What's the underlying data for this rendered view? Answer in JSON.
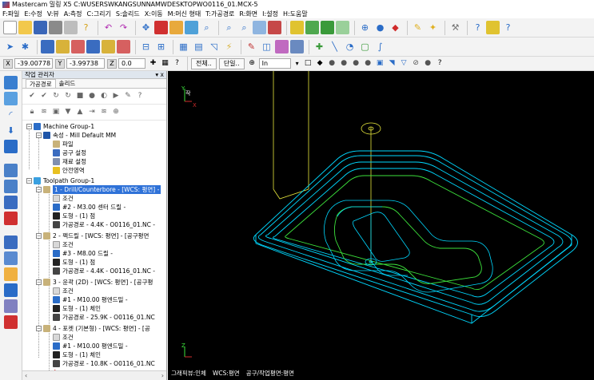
{
  "window": {
    "title": "Mastercam 밀링 X5  C:WUSERSWKANGSUNNAMWDESKTOPWO0116_01.MCX-5"
  },
  "menu": {
    "items": [
      "F:파일",
      "E:수정",
      "V:뷰",
      "A:측정",
      "C:그리기",
      "S:솔리드",
      "X:이동",
      "M:머신 형태",
      "T:가공경로",
      "R:화면",
      "I:설정",
      "H:도움말"
    ]
  },
  "coords": {
    "x_label": "X",
    "x_value": "-39.00778",
    "y_label": "Y",
    "y_value": "-3.99738",
    "z_label": "Z",
    "z_value": "0.0",
    "btn_all": "전체..",
    "btn_single": "단일..",
    "selection_mode": "In"
  },
  "panel": {
    "title": "작업 관리자",
    "close_glyph": "▾ x",
    "tabs": [
      "가공경로",
      "솔리드"
    ]
  },
  "tree": {
    "machine_group": "Machine Group-1",
    "properties": "속성 - Mill Default MM",
    "files": "파일",
    "tool_settings": "공구 설정",
    "stock_settings": "재료 설정",
    "safety_zone": "안전영역",
    "toolpath_group": "Toolpath Group-1",
    "op1": "1 - Drill/Counterbore - [WCS: 평면] -",
    "op1_params": "조건",
    "op1_tool": "#2 - M3.00 센터 드릴 -",
    "op1_geometry": "도형 - (1) 점",
    "op1_toolpath": "가공경로 - 4.4K - O0116_01.NC -",
    "op2": "2 - 펙드릴 - [WCS: 평면] - [공구평면",
    "op2_params": "조건",
    "op2_tool": "#3 - M8.00 드릴 -",
    "op2_geometry": "도형 - (1) 점",
    "op2_toolpath": "가공경로 - 4.4K - O0116_01.NC -",
    "op3": "3 - 윤곽 (2D) - [WCS: 평면] - [공구평",
    "op3_params": "조건",
    "op3_tool": "#1 - M10.00 평엔드밀 -",
    "op3_geometry": "도형 - (1) 체인",
    "op3_toolpath": "가공경로 - 25.9K - O0116_01.NC",
    "op4": "4 - 포켓 (기본형) - [WCS: 평면] - [공",
    "op4_params": "조건",
    "op4_tool": "#1 - M10.00 평엔드밀 -",
    "op4_geometry": "도형 - (1) 체인",
    "op4_toolpath": "가공경로 - 10.8K - O0116_01.NC"
  },
  "viewport": {
    "background": "#000000",
    "axis_y": "Y",
    "axis_x": "X",
    "axis_z": "Z",
    "axis_label": "작",
    "status_graphics": "그래픽뷰:인체",
    "status_wcs": "WCS:평면",
    "status_plane": "공구/작업평면:평면"
  },
  "colors": {
    "toolpath": "#00d8ff",
    "geometry": "#3ce23c",
    "rapid": "#e8e83c",
    "highlight": "#2f72d8"
  }
}
